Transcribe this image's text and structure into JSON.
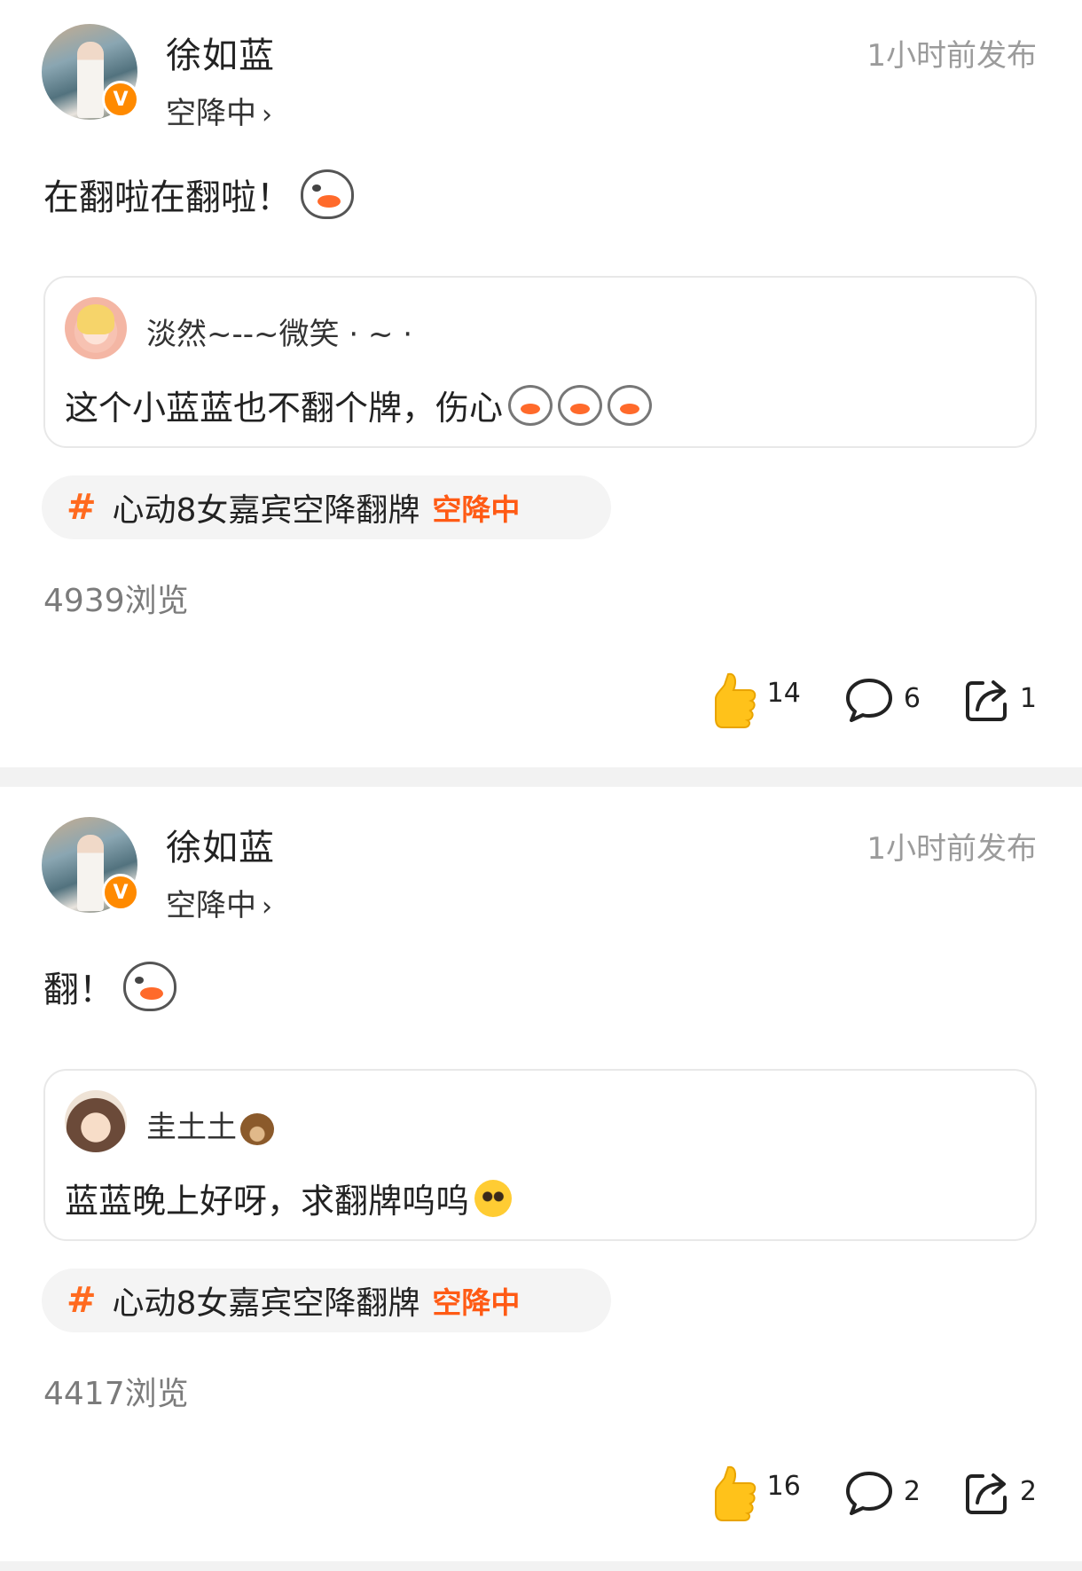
{
  "posts": [
    {
      "author": "徐如蓝",
      "status": "空降中",
      "time": "1小时前发布",
      "text": "在翻啦在翻啦！",
      "quote": {
        "name": "淡然~--~微笑 · ~ ·",
        "text": "这个小蓝蓝也不翻个牌，伤心"
      },
      "topic": {
        "hash": "#",
        "text": "心动8女嘉宾空降翻牌",
        "tag": "空降中"
      },
      "views": "4939浏览",
      "likes": "14",
      "comments": "6",
      "shares": "1"
    },
    {
      "author": "徐如蓝",
      "status": "空降中",
      "time": "1小时前发布",
      "text": "翻！",
      "quote": {
        "name": "圭土土",
        "text": "蓝蓝晚上好呀，求翻牌呜呜"
      },
      "topic": {
        "hash": "#",
        "text": "心动8女嘉宾空降翻牌",
        "tag": "空降中"
      },
      "views": "4417浏览",
      "likes": "16",
      "comments": "2",
      "shares": "2"
    }
  ],
  "colors": {
    "accent": "#ff6a1f",
    "verified": "#ff8a00",
    "muted": "#9b9b9b",
    "like": "#ffc21a"
  },
  "icons": {
    "like": "thumbs-up-icon",
    "comment": "comment-icon",
    "share": "share-icon",
    "verified": "verified-v-icon"
  }
}
